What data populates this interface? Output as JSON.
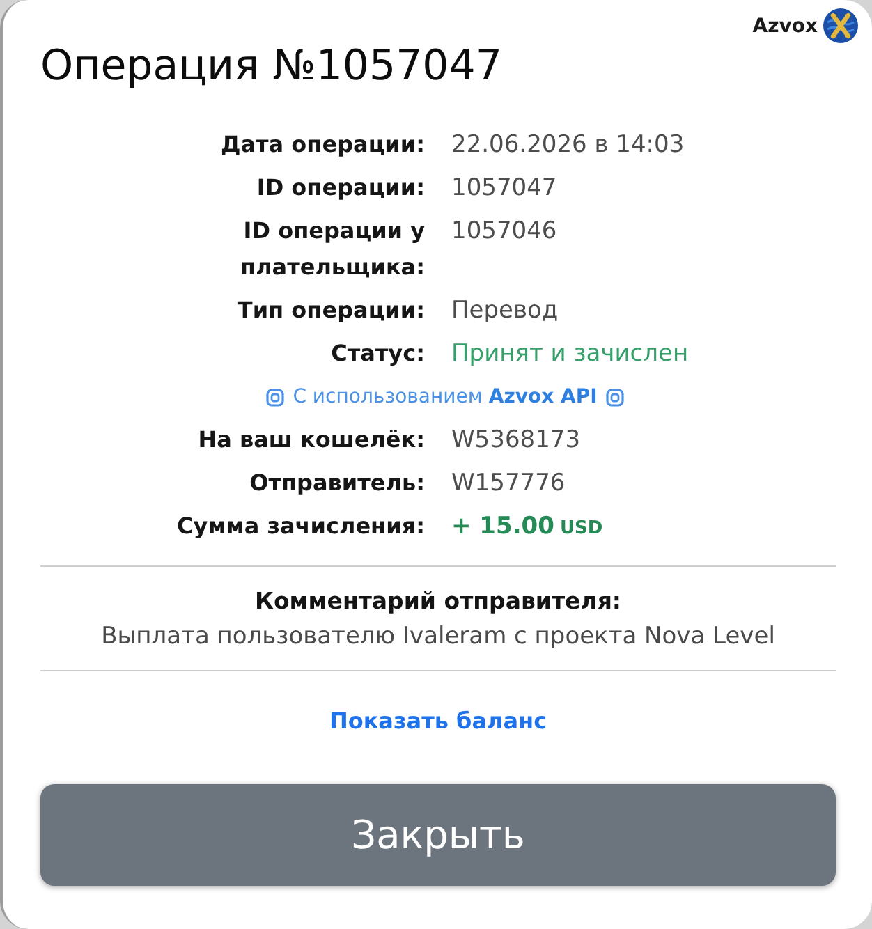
{
  "brand": {
    "name": "Azvox"
  },
  "title": "Операция №1057047",
  "details": [
    {
      "kind": "text",
      "label": "Дата операции:",
      "value": "22.06.2026 в 14:03"
    },
    {
      "kind": "text",
      "label": "ID операции:",
      "value": "1057047"
    },
    {
      "kind": "text",
      "label": "ID операции у плательщика:",
      "value": "1057046"
    },
    {
      "kind": "text",
      "label": "Тип операции:",
      "value": "Перевод"
    },
    {
      "kind": "status",
      "label": "Статус:",
      "value": "Принят и зачислен"
    },
    {
      "kind": "note",
      "text": "С использованием **Azvox API**"
    },
    {
      "kind": "text",
      "label": "На ваш кошелёк:",
      "value": "W5368173"
    },
    {
      "kind": "text",
      "label": "Отправитель:",
      "value": "W157776"
    },
    {
      "kind": "amount",
      "label": "Сумма зачисления:",
      "value": "+ 15.00",
      "unit": "USD"
    }
  ],
  "comment": {
    "heading": "Комментарий отправителя:",
    "text": "Выплата пользователю Ivaleram с проекта Nova Level"
  },
  "link": {
    "label": "Показать баланс"
  },
  "buttons": [
    "Закрыть"
  ]
}
